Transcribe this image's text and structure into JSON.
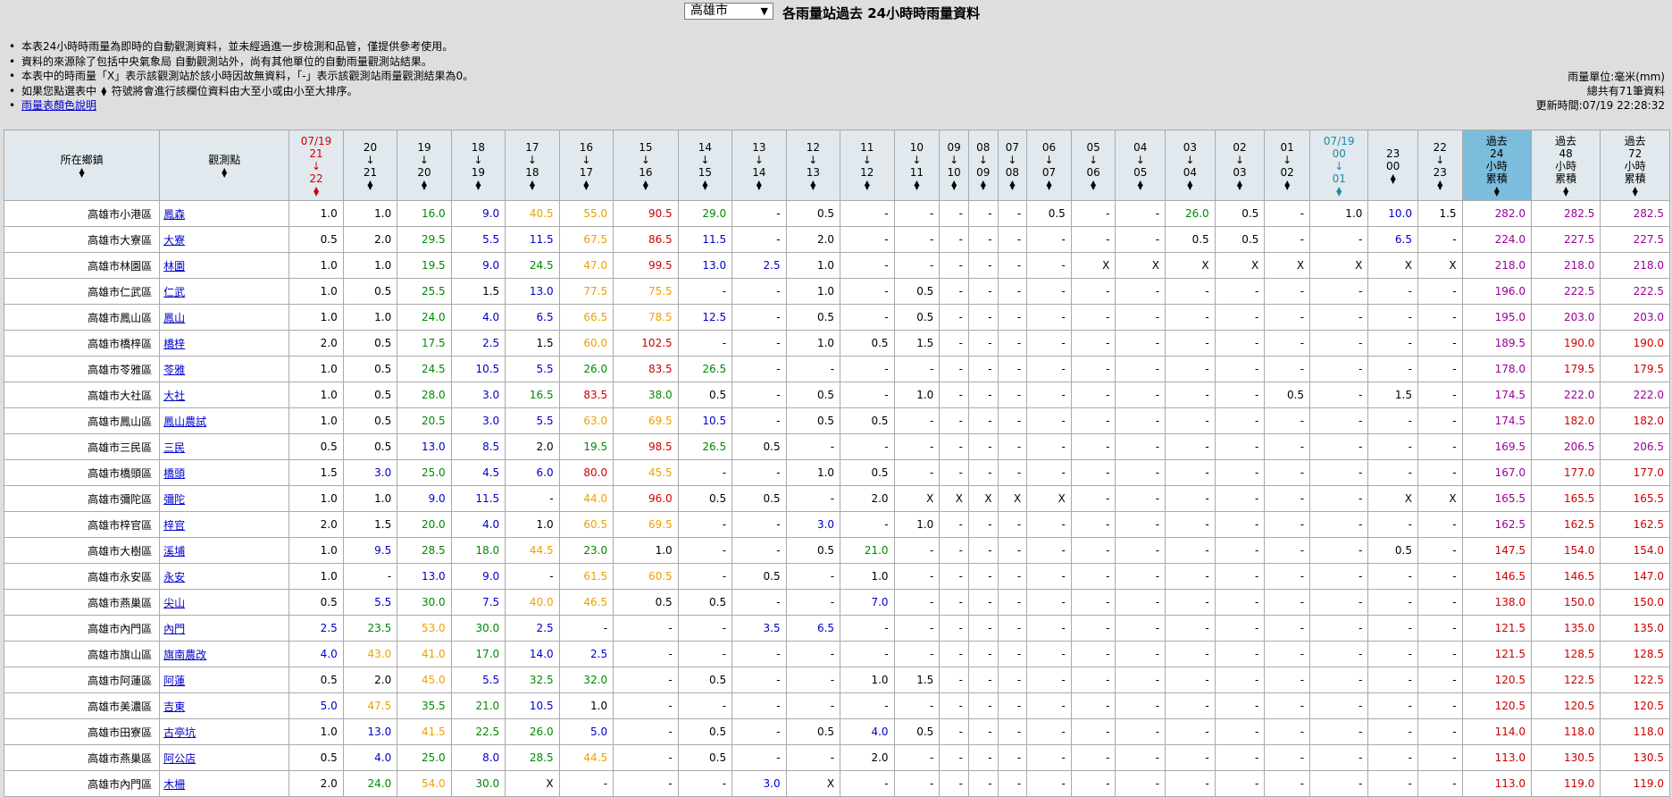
{
  "header": {
    "city_select": "高雄市",
    "title": "各雨量站過去 24小時時雨量資料"
  },
  "notes": {
    "n1": "本表24小時時雨量為即時的自動觀測資料，並未經過進一步檢測和品管，僅提供參考使用。",
    "n2": "資料的來源除了包括中央氣象局 自動觀測站外，尚有其他單位的自動雨量觀測站結果。",
    "n3": "本表中的時雨量「X」表示該觀測站於該小時因故無資料，「-」表示該觀測站雨量觀測結果為0。",
    "n4a": "如果您點選表中",
    "n4b": "符號將會進行該欄位資料由大至小或由小至大排序。",
    "link": "雨量表顏色說明"
  },
  "meta": {
    "unit": "雨量單位:毫米(mm)",
    "count": "總共有71筆資料",
    "updated": "更新時間:07/19 22:28:32"
  },
  "colors": {
    "c1": "#000000",
    "c2": "#0000cc",
    "c3": "#008800",
    "c4": "#eea000",
    "c5": "#cc0000",
    "c6": "#990099"
  },
  "table": {
    "headers": [
      {
        "l1": "所在鄉鎮",
        "l2": "",
        "l3": "",
        "l4": "",
        "cls": ""
      },
      {
        "l1": "觀測點",
        "l2": "",
        "l3": "",
        "l4": "",
        "cls": ""
      },
      {
        "l1": "07/19",
        "l2": "21",
        "l3": "↓",
        "l4": "22",
        "cls": "red"
      },
      {
        "l1": "",
        "l2": "20",
        "l3": "↓",
        "l4": "21",
        "cls": ""
      },
      {
        "l1": "",
        "l2": "19",
        "l3": "↓",
        "l4": "20",
        "cls": ""
      },
      {
        "l1": "",
        "l2": "18",
        "l3": "↓",
        "l4": "19",
        "cls": ""
      },
      {
        "l1": "",
        "l2": "17",
        "l3": "↓",
        "l4": "18",
        "cls": ""
      },
      {
        "l1": "",
        "l2": "16",
        "l3": "↓",
        "l4": "17",
        "cls": ""
      },
      {
        "l1": "",
        "l2": "15",
        "l3": "↓",
        "l4": "16",
        "cls": ""
      },
      {
        "l1": "",
        "l2": "14",
        "l3": "↓",
        "l4": "15",
        "cls": ""
      },
      {
        "l1": "",
        "l2": "13",
        "l3": "↓",
        "l4": "14",
        "cls": ""
      },
      {
        "l1": "",
        "l2": "12",
        "l3": "↓",
        "l4": "13",
        "cls": ""
      },
      {
        "l1": "",
        "l2": "11",
        "l3": "↓",
        "l4": "12",
        "cls": ""
      },
      {
        "l1": "",
        "l2": "10",
        "l3": "↓",
        "l4": "11",
        "cls": ""
      },
      {
        "l1": "",
        "l2": "09",
        "l3": "↓",
        "l4": "10",
        "cls": ""
      },
      {
        "l1": "",
        "l2": "08",
        "l3": "↓",
        "l4": "09",
        "cls": ""
      },
      {
        "l1": "",
        "l2": "07",
        "l3": "↓",
        "l4": "08",
        "cls": ""
      },
      {
        "l1": "",
        "l2": "06",
        "l3": "↓",
        "l4": "07",
        "cls": ""
      },
      {
        "l1": "",
        "l2": "05",
        "l3": "↓",
        "l4": "06",
        "cls": ""
      },
      {
        "l1": "",
        "l2": "04",
        "l3": "↓",
        "l4": "05",
        "cls": ""
      },
      {
        "l1": "",
        "l2": "03",
        "l3": "↓",
        "l4": "04",
        "cls": ""
      },
      {
        "l1": "",
        "l2": "02",
        "l3": "↓",
        "l4": "03",
        "cls": ""
      },
      {
        "l1": "",
        "l2": "01",
        "l3": "↓",
        "l4": "02",
        "cls": ""
      },
      {
        "l1": "07/19",
        "l2": "00",
        "l3": "↓",
        "l4": "01",
        "cls": "blue"
      },
      {
        "l1": "",
        "l2": "23",
        "l3": "",
        "l4": "00",
        "cls": ""
      },
      {
        "l1": "",
        "l2": "22",
        "l3": "↓",
        "l4": "23",
        "cls": ""
      },
      {
        "l1": "過去",
        "l2": "24",
        "l3": "小時",
        "l4": "累積",
        "cls": "hl"
      },
      {
        "l1": "過去",
        "l2": "48",
        "l3": "小時",
        "l4": "累積",
        "cls": ""
      },
      {
        "l1": "過去",
        "l2": "72",
        "l3": "小時",
        "l4": "累積",
        "cls": ""
      }
    ],
    "rows": [
      {
        "town": "高雄市小港區",
        "station": "鳳森",
        "v": [
          "1.0",
          "1.0",
          "16.0",
          "9.0",
          "40.5",
          "55.0",
          "90.5",
          "29.0",
          "-",
          "0.5",
          "-",
          "-",
          "-",
          "-",
          "-",
          "0.5",
          "-",
          "-",
          "26.0",
          "0.5",
          "-",
          "1.0",
          "10.0",
          "1.5",
          "282.0",
          "282.5",
          "282.5"
        ]
      },
      {
        "town": "高雄市大寮區",
        "station": "大寮",
        "v": [
          "0.5",
          "2.0",
          "29.5",
          "5.5",
          "11.5",
          "67.5",
          "86.5",
          "11.5",
          "-",
          "2.0",
          "-",
          "-",
          "-",
          "-",
          "-",
          "-",
          "-",
          "-",
          "0.5",
          "0.5",
          "-",
          "-",
          "6.5",
          "-",
          "224.0",
          "227.5",
          "227.5"
        ]
      },
      {
        "town": "高雄市林園區",
        "station": "林園",
        "v": [
          "1.0",
          "1.0",
          "19.5",
          "9.0",
          "24.5",
          "47.0",
          "99.5",
          "13.0",
          "2.5",
          "1.0",
          "-",
          "-",
          "-",
          "-",
          "-",
          "-",
          "X",
          "X",
          "X",
          "X",
          "X",
          "X",
          "X",
          "X",
          "218.0",
          "218.0",
          "218.0"
        ]
      },
      {
        "town": "高雄市仁武區",
        "station": "仁武",
        "v": [
          "1.0",
          "0.5",
          "25.5",
          "1.5",
          "13.0",
          "77.5",
          "75.5",
          "-",
          "-",
          "1.0",
          "-",
          "0.5",
          "-",
          "-",
          "-",
          "-",
          "-",
          "-",
          "-",
          "-",
          "-",
          "-",
          "-",
          "-",
          "196.0",
          "222.5",
          "222.5"
        ]
      },
      {
        "town": "高雄市鳳山區",
        "station": "鳳山",
        "v": [
          "1.0",
          "1.0",
          "24.0",
          "4.0",
          "6.5",
          "66.5",
          "78.5",
          "12.5",
          "-",
          "0.5",
          "-",
          "0.5",
          "-",
          "-",
          "-",
          "-",
          "-",
          "-",
          "-",
          "-",
          "-",
          "-",
          "-",
          "-",
          "195.0",
          "203.0",
          "203.0"
        ]
      },
      {
        "town": "高雄市橋梓區",
        "station": "橋梓",
        "v": [
          "2.0",
          "0.5",
          "17.5",
          "2.5",
          "1.5",
          "60.0",
          "102.5",
          "-",
          "-",
          "1.0",
          "0.5",
          "1.5",
          "-",
          "-",
          "-",
          "-",
          "-",
          "-",
          "-",
          "-",
          "-",
          "-",
          "-",
          "-",
          "189.5",
          "190.0",
          "190.0"
        ]
      },
      {
        "town": "高雄市苓雅區",
        "station": "苓雅",
        "v": [
          "1.0",
          "0.5",
          "24.5",
          "10.5",
          "5.5",
          "26.0",
          "83.5",
          "26.5",
          "-",
          "-",
          "-",
          "-",
          "-",
          "-",
          "-",
          "-",
          "-",
          "-",
          "-",
          "-",
          "-",
          "-",
          "-",
          "-",
          "178.0",
          "179.5",
          "179.5"
        ]
      },
      {
        "town": "高雄市大社區",
        "station": "大社",
        "v": [
          "1.0",
          "0.5",
          "28.0",
          "3.0",
          "16.5",
          "83.5",
          "38.0",
          "0.5",
          "-",
          "0.5",
          "-",
          "1.0",
          "-",
          "-",
          "-",
          "-",
          "-",
          "-",
          "-",
          "-",
          "0.5",
          "-",
          "1.5",
          "-",
          "174.5",
          "222.0",
          "222.0"
        ]
      },
      {
        "town": "高雄市鳳山區",
        "station": "鳳山農試",
        "v": [
          "1.0",
          "0.5",
          "20.5",
          "3.0",
          "5.5",
          "63.0",
          "69.5",
          "10.5",
          "-",
          "0.5",
          "0.5",
          "-",
          "-",
          "-",
          "-",
          "-",
          "-",
          "-",
          "-",
          "-",
          "-",
          "-",
          "-",
          "-",
          "174.5",
          "182.0",
          "182.0"
        ]
      },
      {
        "town": "高雄市三民區",
        "station": "三民",
        "v": [
          "0.5",
          "0.5",
          "13.0",
          "8.5",
          "2.0",
          "19.5",
          "98.5",
          "26.5",
          "0.5",
          "-",
          "-",
          "-",
          "-",
          "-",
          "-",
          "-",
          "-",
          "-",
          "-",
          "-",
          "-",
          "-",
          "-",
          "-",
          "169.5",
          "206.5",
          "206.5"
        ]
      },
      {
        "town": "高雄市橋頭區",
        "station": "橋頭",
        "v": [
          "1.5",
          "3.0",
          "25.0",
          "4.5",
          "6.0",
          "80.0",
          "45.5",
          "-",
          "-",
          "1.0",
          "0.5",
          "-",
          "-",
          "-",
          "-",
          "-",
          "-",
          "-",
          "-",
          "-",
          "-",
          "-",
          "-",
          "-",
          "167.0",
          "177.0",
          "177.0"
        ]
      },
      {
        "town": "高雄市彌陀區",
        "station": "彌陀",
        "v": [
          "1.0",
          "1.0",
          "9.0",
          "11.5",
          "-",
          "44.0",
          "96.0",
          "0.5",
          "0.5",
          "-",
          "2.0",
          "X",
          "X",
          "X",
          "X",
          "X",
          "-",
          "-",
          "-",
          "-",
          "-",
          "-",
          "X",
          "X",
          "165.5",
          "165.5",
          "165.5"
        ]
      },
      {
        "town": "高雄市梓官區",
        "station": "梓官",
        "v": [
          "2.0",
          "1.5",
          "20.0",
          "4.0",
          "1.0",
          "60.5",
          "69.5",
          "-",
          "-",
          "3.0",
          "-",
          "1.0",
          "-",
          "-",
          "-",
          "-",
          "-",
          "-",
          "-",
          "-",
          "-",
          "-",
          "-",
          "-",
          "162.5",
          "162.5",
          "162.5"
        ]
      },
      {
        "town": "高雄市大樹區",
        "station": "溪埔",
        "v": [
          "1.0",
          "9.5",
          "28.5",
          "18.0",
          "44.5",
          "23.0",
          "1.0",
          "-",
          "-",
          "0.5",
          "21.0",
          "-",
          "-",
          "-",
          "-",
          "-",
          "-",
          "-",
          "-",
          "-",
          "-",
          "-",
          "0.5",
          "-",
          "147.5",
          "154.0",
          "154.0"
        ]
      },
      {
        "town": "高雄市永安區",
        "station": "永安",
        "v": [
          "1.0",
          "-",
          "13.0",
          "9.0",
          "-",
          "61.5",
          "60.5",
          "-",
          "0.5",
          "-",
          "1.0",
          "-",
          "-",
          "-",
          "-",
          "-",
          "-",
          "-",
          "-",
          "-",
          "-",
          "-",
          "-",
          "-",
          "146.5",
          "146.5",
          "147.0"
        ]
      },
      {
        "town": "高雄市燕巢區",
        "station": "尖山",
        "v": [
          "0.5",
          "5.5",
          "30.0",
          "7.5",
          "40.0",
          "46.5",
          "0.5",
          "0.5",
          "-",
          "-",
          "7.0",
          "-",
          "-",
          "-",
          "-",
          "-",
          "-",
          "-",
          "-",
          "-",
          "-",
          "-",
          "-",
          "-",
          "138.0",
          "150.0",
          "150.0"
        ]
      },
      {
        "town": "高雄市內門區",
        "station": "內門",
        "v": [
          "2.5",
          "23.5",
          "53.0",
          "30.0",
          "2.5",
          "-",
          "-",
          "-",
          "3.5",
          "6.5",
          "-",
          "-",
          "-",
          "-",
          "-",
          "-",
          "-",
          "-",
          "-",
          "-",
          "-",
          "-",
          "-",
          "-",
          "121.5",
          "135.0",
          "135.0"
        ]
      },
      {
        "town": "高雄市旗山區",
        "station": "旗南農改",
        "v": [
          "4.0",
          "43.0",
          "41.0",
          "17.0",
          "14.0",
          "2.5",
          "-",
          "-",
          "-",
          "-",
          "-",
          "-",
          "-",
          "-",
          "-",
          "-",
          "-",
          "-",
          "-",
          "-",
          "-",
          "-",
          "-",
          "-",
          "121.5",
          "128.5",
          "128.5"
        ]
      },
      {
        "town": "高雄市阿蓮區",
        "station": "阿蓮",
        "v": [
          "0.5",
          "2.0",
          "45.0",
          "5.5",
          "32.5",
          "32.0",
          "-",
          "0.5",
          "-",
          "-",
          "1.0",
          "1.5",
          "-",
          "-",
          "-",
          "-",
          "-",
          "-",
          "-",
          "-",
          "-",
          "-",
          "-",
          "-",
          "120.5",
          "122.5",
          "122.5"
        ]
      },
      {
        "town": "高雄市美濃區",
        "station": "吉東",
        "v": [
          "5.0",
          "47.5",
          "35.5",
          "21.0",
          "10.5",
          "1.0",
          "-",
          "-",
          "-",
          "-",
          "-",
          "-",
          "-",
          "-",
          "-",
          "-",
          "-",
          "-",
          "-",
          "-",
          "-",
          "-",
          "-",
          "-",
          "120.5",
          "120.5",
          "120.5"
        ]
      },
      {
        "town": "高雄市田寮區",
        "station": "古亭坑",
        "v": [
          "1.0",
          "13.0",
          "41.5",
          "22.5",
          "26.0",
          "5.0",
          "-",
          "0.5",
          "-",
          "0.5",
          "4.0",
          "0.5",
          "-",
          "-",
          "-",
          "-",
          "-",
          "-",
          "-",
          "-",
          "-",
          "-",
          "-",
          "-",
          "114.0",
          "118.0",
          "118.0"
        ]
      },
      {
        "town": "高雄市燕巢區",
        "station": "阿公店",
        "v": [
          "0.5",
          "4.0",
          "25.0",
          "8.0",
          "28.5",
          "44.5",
          "-",
          "0.5",
          "-",
          "-",
          "2.0",
          "-",
          "-",
          "-",
          "-",
          "-",
          "-",
          "-",
          "-",
          "-",
          "-",
          "-",
          "-",
          "-",
          "113.0",
          "130.5",
          "130.5"
        ]
      },
      {
        "town": "高雄市內門區",
        "station": "木柵",
        "v": [
          "2.0",
          "24.0",
          "54.0",
          "30.0",
          "X",
          "-",
          "-",
          "-",
          "3.0",
          "X",
          "-",
          "-",
          "-",
          "-",
          "-",
          "-",
          "-",
          "-",
          "-",
          "-",
          "-",
          "-",
          "-",
          "-",
          "113.0",
          "119.0",
          "119.0"
        ]
      }
    ]
  }
}
